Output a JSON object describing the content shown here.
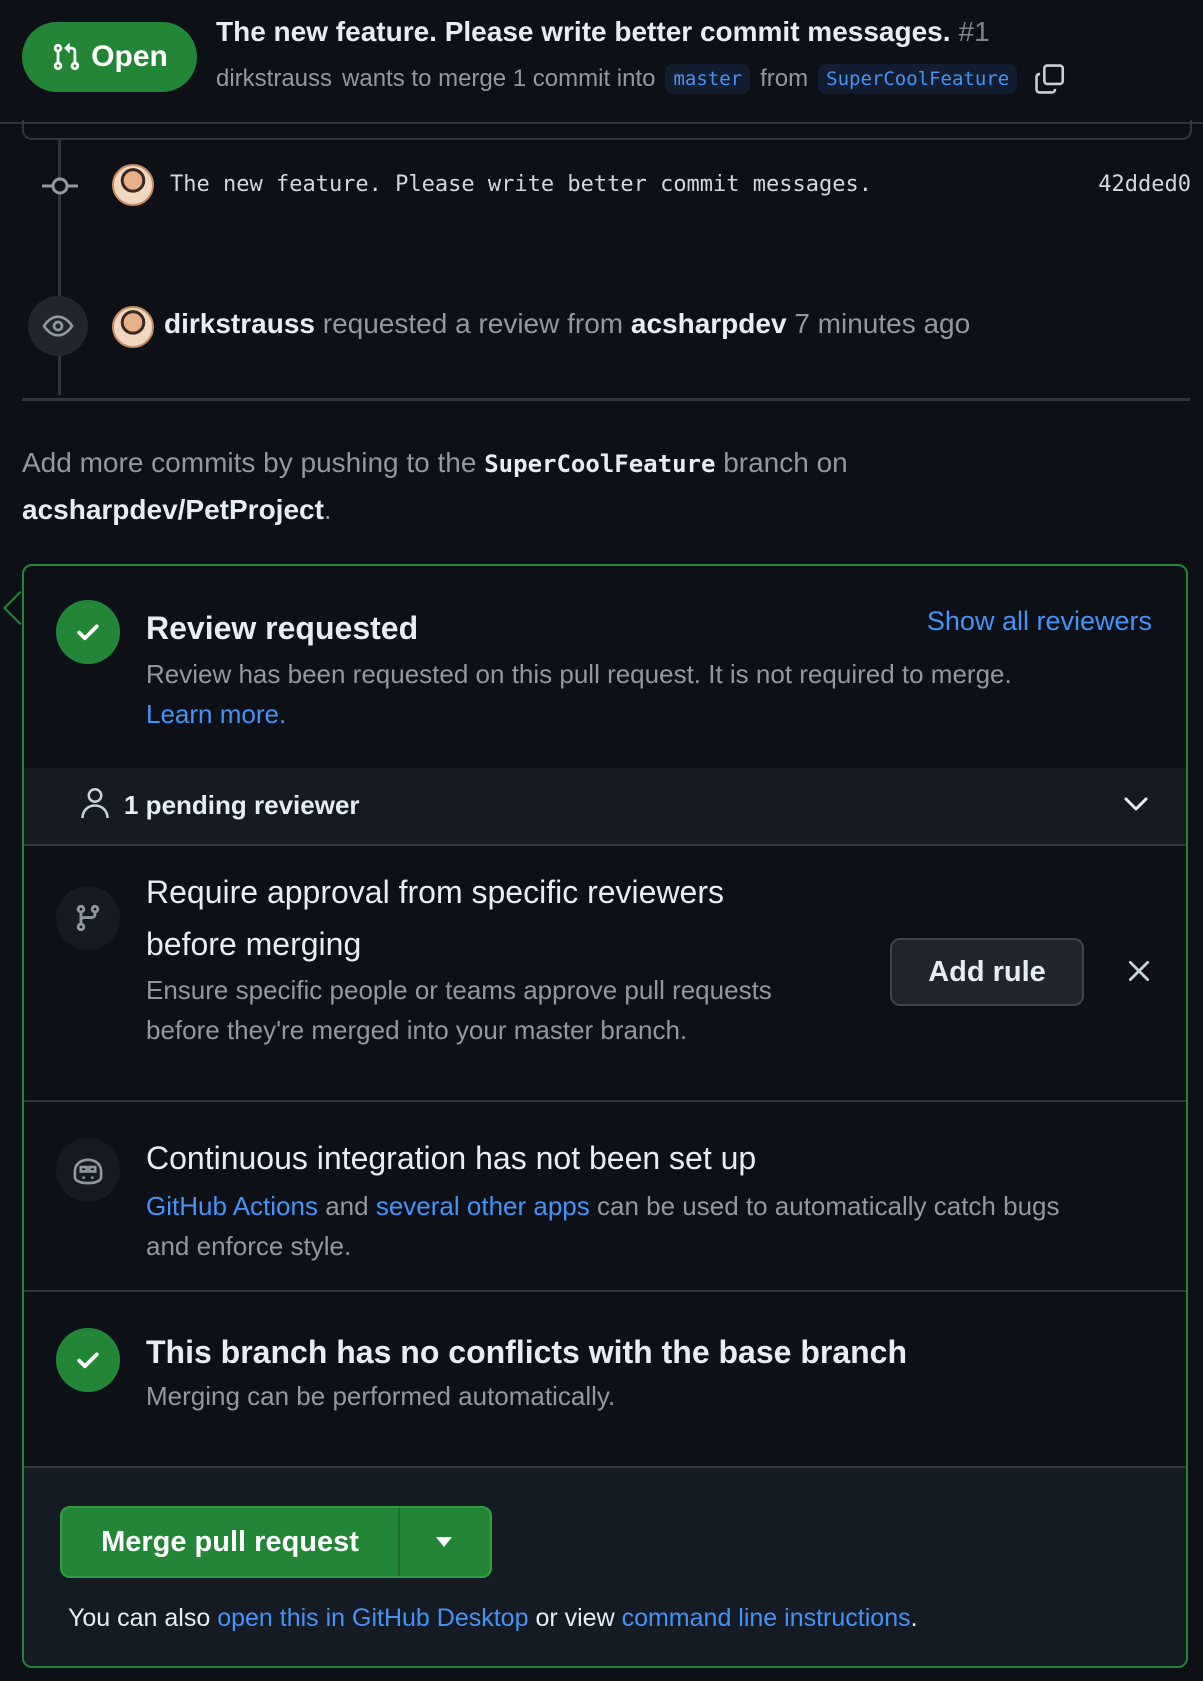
{
  "pr": {
    "state": "Open",
    "title": "The new feature. Please write better commit messages.",
    "number": "#1",
    "author": "dirkstrauss",
    "merge_text": "wants to merge 1 commit into",
    "base_branch": "master",
    "from_text": "from",
    "head_branch": "SuperCoolFeature"
  },
  "timeline": {
    "commit": {
      "message": "The new feature. Please write better commit messages.",
      "sha": "42dded0"
    },
    "review_event": {
      "actor": "dirkstrauss",
      "action": "requested a review from",
      "reviewer": "acsharpdev",
      "time": "7 minutes ago"
    }
  },
  "add_commits": {
    "prefix": "Add more commits by pushing to the",
    "branch": "SuperCoolFeature",
    "middle": "branch on",
    "repo": "acsharpdev/PetProject",
    "suffix": "."
  },
  "merge_box": {
    "review": {
      "title": "Review requested",
      "show_all": "Show all reviewers",
      "description": "Review has been requested on this pull request. It is not required to merge.",
      "learn_more": "Learn more."
    },
    "pending": {
      "label": "1 pending reviewer"
    },
    "rule": {
      "title_line1": "Require approval from specific reviewers",
      "title_line2": "before merging",
      "desc_line1": "Ensure specific people or teams approve pull requests",
      "desc_line2": "before they're merged into your master branch.",
      "button": "Add rule"
    },
    "ci": {
      "title": "Continuous integration has not been set up",
      "link1": "GitHub Actions",
      "and": "and",
      "link2": "several other apps",
      "rest_line1": "can be used to automatically catch bugs",
      "rest_line2": "and enforce style."
    },
    "conflicts": {
      "title": "This branch has no conflicts with the base branch",
      "description": "Merging can be performed automatically."
    },
    "merge": {
      "button": "Merge pull request",
      "note_prefix": "You can also",
      "desktop_link": "open this in GitHub Desktop",
      "or_view": "or view",
      "cli_link": "command line instructions",
      "note_suffix": "."
    }
  },
  "colors": {
    "background": "#0d1117",
    "green": "#238636",
    "link": "#4493f8",
    "muted": "#9198a1",
    "border": "#30363d"
  },
  "icons": [
    "git-pull-request-icon",
    "copy-icon",
    "commit-icon",
    "eye-icon",
    "check-icon",
    "person-icon",
    "chevron-down-icon",
    "branch-icon",
    "close-icon",
    "copilot-icon",
    "triangle-down-icon"
  ]
}
